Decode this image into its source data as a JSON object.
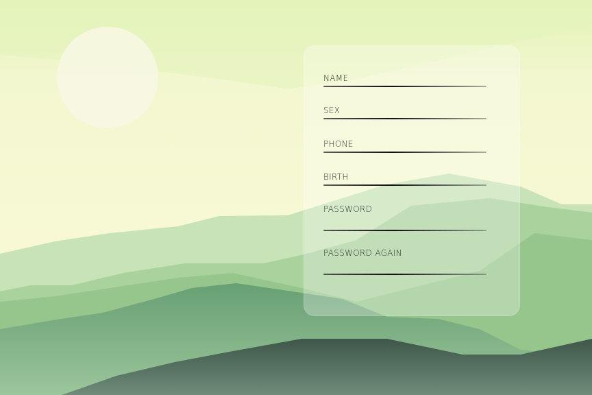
{
  "form": {
    "fields": [
      {
        "label": "NAME"
      },
      {
        "label": "SEX"
      },
      {
        "label": "PHONE"
      },
      {
        "label": "BIRTH"
      },
      {
        "label": "PASSWORD"
      },
      {
        "label": "PASSWORD AGAIN"
      }
    ]
  },
  "colors": {
    "sky_top": "#e2f3b8",
    "sky_bottom": "#fbf8d9",
    "sun": "#f8f7e6",
    "hill_light": "#c3e0b6",
    "hill_mid": "#9ac891",
    "hill_deep": "#6aa27a",
    "hill_dark": "#3a5548"
  }
}
